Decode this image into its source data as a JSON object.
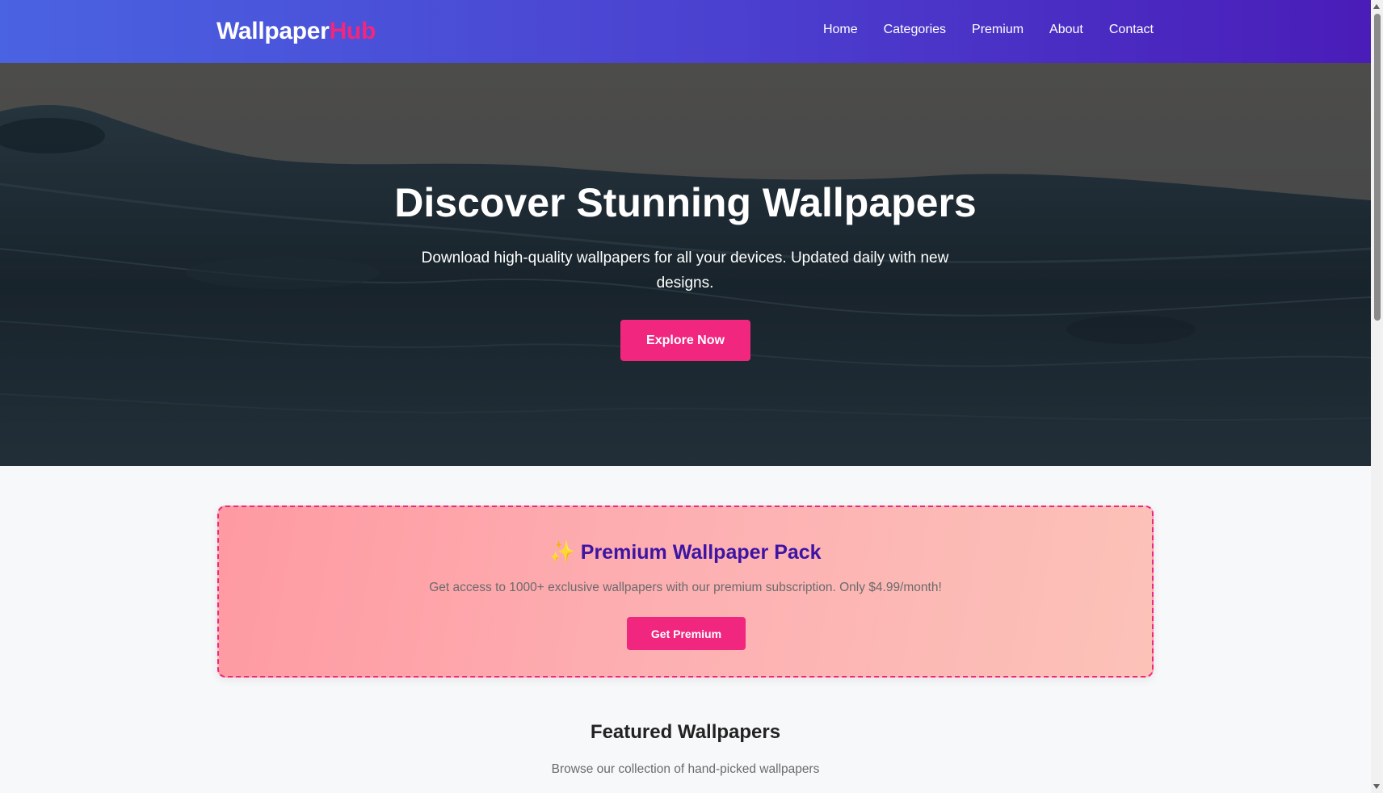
{
  "brand": {
    "name_main": "Wallpaper",
    "name_accent": "Hub"
  },
  "nav": {
    "items": [
      {
        "label": "Home"
      },
      {
        "label": "Categories"
      },
      {
        "label": "Premium"
      },
      {
        "label": "About"
      },
      {
        "label": "Contact"
      }
    ]
  },
  "hero": {
    "title": "Discover Stunning Wallpapers",
    "subtitle": "Download high-quality wallpapers for all your devices. Updated daily with new designs.",
    "cta_label": "Explore Now"
  },
  "premium": {
    "icon": "sparkle-icon",
    "title": "Premium Wallpaper Pack",
    "description": "Get access to 1000+ exclusive wallpapers with our premium subscription. Only $4.99/month!",
    "cta_label": "Get Premium"
  },
  "featured": {
    "title": "Featured Wallpapers",
    "subtitle": "Browse our collection of hand-picked wallpapers"
  },
  "colors": {
    "accent": "#f0267f",
    "nav_gradient_start": "#4a63e2",
    "nav_gradient_end": "#4a1cb8",
    "premium_title": "#3d14a3"
  }
}
